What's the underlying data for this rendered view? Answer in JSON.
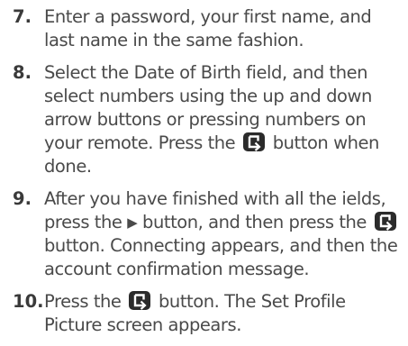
{
  "steps": [
    {
      "number": "7.",
      "text": "Enter a password, your first name, and last name in the same fashion."
    },
    {
      "number": "8.",
      "text_before": "Select the Date of Birth field, and then select numbers using the up and down arrow buttons or pressing numbers on your remote. Press the",
      "text_after": "button when done."
    },
    {
      "number": "9.",
      "text_a": "After you have finished with all the ields, press the",
      "text_b": "button, and then press the",
      "text_c": "button. Connecting appears, and then the account confirmation message."
    },
    {
      "number": "10.",
      "text_before": "Press the",
      "text_after": "button. The Set Profile Picture screen appears."
    }
  ],
  "icons": {
    "enter": "enter-button-icon",
    "play": "play-triangle-icon",
    "play_glyph": "▶"
  },
  "colors": {
    "text": "#4a4a4a",
    "number": "#3a3a3a",
    "icon_bg": "#2b2b2b",
    "icon_fg": "#ffffff"
  }
}
